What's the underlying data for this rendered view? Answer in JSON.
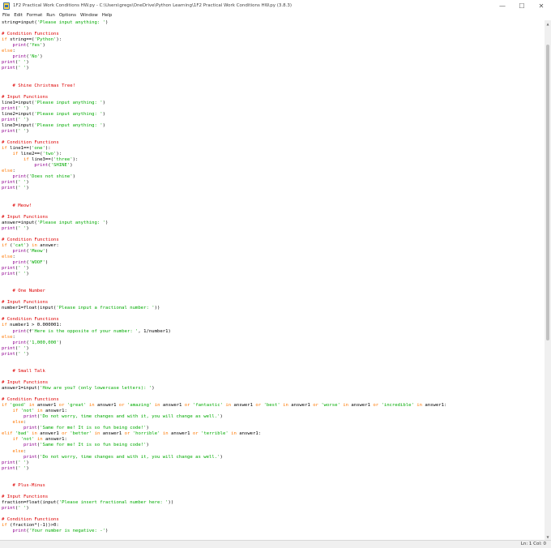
{
  "window": {
    "title": "1F2 Practical Work Conditions HW.py - C:\\Users\\gregs\\OneDrive\\Python Learning\\1F2 Practical Work Conditions HW.py (3.8.3)",
    "minimize": "—",
    "maximize": "☐",
    "close": "✕"
  },
  "menu": {
    "items": [
      "File",
      "Edit",
      "Format",
      "Run",
      "Options",
      "Window",
      "Help"
    ]
  },
  "status": {
    "position": "Ln: 1   Col: 0"
  },
  "scroll": {
    "up": "▲",
    "down": "▼"
  },
  "code_lines": [
    [
      {
        "t": "string=input("
      },
      {
        "t": "'Please input anything: '",
        "c": "string"
      },
      {
        "t": ")"
      }
    ],
    [],
    [
      {
        "t": "# Condition Functions",
        "c": "comment"
      }
    ],
    [
      {
        "t": "if",
        "c": "keyword"
      },
      {
        "t": " string==("
      },
      {
        "t": "'Python'",
        "c": "string"
      },
      {
        "t": "):"
      }
    ],
    [
      {
        "t": "    "
      },
      {
        "t": "print",
        "c": "builtin"
      },
      {
        "t": "("
      },
      {
        "t": "'Yes'",
        "c": "string"
      },
      {
        "t": ")"
      }
    ],
    [
      {
        "t": "else",
        "c": "keyword"
      },
      {
        "t": ":"
      }
    ],
    [
      {
        "t": "    "
      },
      {
        "t": "print",
        "c": "builtin"
      },
      {
        "t": "("
      },
      {
        "t": "'No'",
        "c": "string"
      },
      {
        "t": ")"
      }
    ],
    [
      {
        "t": "print",
        "c": "builtin"
      },
      {
        "t": "("
      },
      {
        "t": "' '",
        "c": "string"
      },
      {
        "t": ")"
      }
    ],
    [
      {
        "t": "print",
        "c": "builtin"
      },
      {
        "t": "("
      },
      {
        "t": "' '",
        "c": "string"
      },
      {
        "t": ")"
      }
    ],
    [],
    [],
    [
      {
        "t": "    "
      },
      {
        "t": "# Shine Christmas Tree!",
        "c": "comment"
      }
    ],
    [],
    [
      {
        "t": "# Input Functions",
        "c": "comment"
      }
    ],
    [
      {
        "t": "line1=input("
      },
      {
        "t": "'Please input anything: '",
        "c": "string"
      },
      {
        "t": ")"
      }
    ],
    [
      {
        "t": "print",
        "c": "builtin"
      },
      {
        "t": "("
      },
      {
        "t": "' '",
        "c": "string"
      },
      {
        "t": ")"
      }
    ],
    [
      {
        "t": "line2=input("
      },
      {
        "t": "'Please input anything: '",
        "c": "string"
      },
      {
        "t": ")"
      }
    ],
    [
      {
        "t": "print",
        "c": "builtin"
      },
      {
        "t": "("
      },
      {
        "t": "' '",
        "c": "string"
      },
      {
        "t": ")"
      }
    ],
    [
      {
        "t": "line3=input("
      },
      {
        "t": "'Please input anything: '",
        "c": "string"
      },
      {
        "t": ")"
      }
    ],
    [
      {
        "t": "print",
        "c": "builtin"
      },
      {
        "t": "("
      },
      {
        "t": "' '",
        "c": "string"
      },
      {
        "t": ")"
      }
    ],
    [],
    [
      {
        "t": "# Condition Functions",
        "c": "comment"
      }
    ],
    [
      {
        "t": "if",
        "c": "keyword"
      },
      {
        "t": " line1==("
      },
      {
        "t": "'one'",
        "c": "string"
      },
      {
        "t": "):"
      }
    ],
    [
      {
        "t": "    "
      },
      {
        "t": "if",
        "c": "keyword"
      },
      {
        "t": " line2==("
      },
      {
        "t": "'two'",
        "c": "string"
      },
      {
        "t": "):"
      }
    ],
    [
      {
        "t": "        "
      },
      {
        "t": "if",
        "c": "keyword"
      },
      {
        "t": " line3==("
      },
      {
        "t": "'three'",
        "c": "string"
      },
      {
        "t": "):"
      }
    ],
    [
      {
        "t": "            "
      },
      {
        "t": "print",
        "c": "builtin"
      },
      {
        "t": "("
      },
      {
        "t": "'SHINE'",
        "c": "string"
      },
      {
        "t": ")"
      }
    ],
    [
      {
        "t": "else",
        "c": "keyword"
      },
      {
        "t": ":"
      }
    ],
    [
      {
        "t": "    "
      },
      {
        "t": "print",
        "c": "builtin"
      },
      {
        "t": "("
      },
      {
        "t": "'Does not shine'",
        "c": "string"
      },
      {
        "t": ")"
      }
    ],
    [
      {
        "t": "print",
        "c": "builtin"
      },
      {
        "t": "("
      },
      {
        "t": "' '",
        "c": "string"
      },
      {
        "t": ")"
      }
    ],
    [
      {
        "t": "print",
        "c": "builtin"
      },
      {
        "t": "("
      },
      {
        "t": "' '",
        "c": "string"
      },
      {
        "t": ")"
      }
    ],
    [],
    [],
    [
      {
        "t": "    "
      },
      {
        "t": "# Meow!",
        "c": "comment"
      }
    ],
    [],
    [
      {
        "t": "# Input Functions",
        "c": "comment"
      }
    ],
    [
      {
        "t": "answer=input("
      },
      {
        "t": "'Please input anything: '",
        "c": "string"
      },
      {
        "t": ")"
      }
    ],
    [
      {
        "t": "print",
        "c": "builtin"
      },
      {
        "t": "("
      },
      {
        "t": "' '",
        "c": "string"
      },
      {
        "t": ")"
      }
    ],
    [],
    [
      {
        "t": "# Condition Functions",
        "c": "comment"
      }
    ],
    [
      {
        "t": "if",
        "c": "keyword"
      },
      {
        "t": " ("
      },
      {
        "t": "'cat'",
        "c": "string"
      },
      {
        "t": ") "
      },
      {
        "t": "in",
        "c": "keyword"
      },
      {
        "t": " answer:"
      }
    ],
    [
      {
        "t": "    "
      },
      {
        "t": "print",
        "c": "builtin"
      },
      {
        "t": "("
      },
      {
        "t": "'Meow'",
        "c": "string"
      },
      {
        "t": ")"
      }
    ],
    [
      {
        "t": "else",
        "c": "keyword"
      },
      {
        "t": ":"
      }
    ],
    [
      {
        "t": "    "
      },
      {
        "t": "print",
        "c": "builtin"
      },
      {
        "t": "("
      },
      {
        "t": "'WOOF'",
        "c": "string"
      },
      {
        "t": ")"
      }
    ],
    [
      {
        "t": "print",
        "c": "builtin"
      },
      {
        "t": "("
      },
      {
        "t": "' '",
        "c": "string"
      },
      {
        "t": ")"
      }
    ],
    [
      {
        "t": "print",
        "c": "builtin"
      },
      {
        "t": "("
      },
      {
        "t": "' '",
        "c": "string"
      },
      {
        "t": ")"
      }
    ],
    [],
    [],
    [
      {
        "t": "    "
      },
      {
        "t": "# One Number",
        "c": "comment"
      }
    ],
    [],
    [
      {
        "t": "# Input Functions",
        "c": "comment"
      }
    ],
    [
      {
        "t": "number1=float(input("
      },
      {
        "t": "'Please input a fractional number: '",
        "c": "string"
      },
      {
        "t": "))"
      }
    ],
    [],
    [
      {
        "t": "# Condition Functions",
        "c": "comment"
      }
    ],
    [
      {
        "t": "if",
        "c": "keyword"
      },
      {
        "t": " number1 > 0.000001:"
      }
    ],
    [
      {
        "t": "    "
      },
      {
        "t": "print",
        "c": "builtin"
      },
      {
        "t": "(f"
      },
      {
        "t": "'Here is the opposite of your number: '",
        "c": "string"
      },
      {
        "t": ", 1/number1)"
      }
    ],
    [
      {
        "t": "else",
        "c": "keyword"
      },
      {
        "t": ":"
      }
    ],
    [
      {
        "t": "    "
      },
      {
        "t": "print",
        "c": "builtin"
      },
      {
        "t": "("
      },
      {
        "t": "'1,000,000'",
        "c": "string"
      },
      {
        "t": ")"
      }
    ],
    [
      {
        "t": "print",
        "c": "builtin"
      },
      {
        "t": "("
      },
      {
        "t": "' '",
        "c": "string"
      },
      {
        "t": ")"
      }
    ],
    [
      {
        "t": "print",
        "c": "builtin"
      },
      {
        "t": "("
      },
      {
        "t": "' '",
        "c": "string"
      },
      {
        "t": ")"
      }
    ],
    [],
    [],
    [
      {
        "t": "    "
      },
      {
        "t": "# Small Talk",
        "c": "comment"
      }
    ],
    [],
    [
      {
        "t": "# Input Functions",
        "c": "comment"
      }
    ],
    [
      {
        "t": "answer1=input("
      },
      {
        "t": "'How are you? (only lowercase letters): '",
        "c": "string"
      },
      {
        "t": ")"
      }
    ],
    [],
    [
      {
        "t": "# Condition Functions",
        "c": "comment"
      }
    ],
    [
      {
        "t": "if",
        "c": "keyword"
      },
      {
        "t": " "
      },
      {
        "t": "'good'",
        "c": "string"
      },
      {
        "t": " "
      },
      {
        "t": "in",
        "c": "keyword"
      },
      {
        "t": " answer1 "
      },
      {
        "t": "or",
        "c": "keyword"
      },
      {
        "t": " "
      },
      {
        "t": "'great'",
        "c": "string"
      },
      {
        "t": " "
      },
      {
        "t": "in",
        "c": "keyword"
      },
      {
        "t": " answer1 "
      },
      {
        "t": "or",
        "c": "keyword"
      },
      {
        "t": " "
      },
      {
        "t": "'amazing'",
        "c": "string"
      },
      {
        "t": " "
      },
      {
        "t": "in",
        "c": "keyword"
      },
      {
        "t": " answer1 "
      },
      {
        "t": "or",
        "c": "keyword"
      },
      {
        "t": " "
      },
      {
        "t": "'fantastic'",
        "c": "string"
      },
      {
        "t": " "
      },
      {
        "t": "in",
        "c": "keyword"
      },
      {
        "t": " answer1 "
      },
      {
        "t": "or",
        "c": "keyword"
      },
      {
        "t": " "
      },
      {
        "t": "'best'",
        "c": "string"
      },
      {
        "t": " "
      },
      {
        "t": "in",
        "c": "keyword"
      },
      {
        "t": " answer1 "
      },
      {
        "t": "or",
        "c": "keyword"
      },
      {
        "t": " "
      },
      {
        "t": "'worse'",
        "c": "string"
      },
      {
        "t": " "
      },
      {
        "t": "in",
        "c": "keyword"
      },
      {
        "t": " answer1 "
      },
      {
        "t": "or",
        "c": "keyword"
      },
      {
        "t": " "
      },
      {
        "t": "'incredible'",
        "c": "string"
      },
      {
        "t": " "
      },
      {
        "t": "in",
        "c": "keyword"
      },
      {
        "t": " answer1:"
      }
    ],
    [
      {
        "t": "    "
      },
      {
        "t": "if",
        "c": "keyword"
      },
      {
        "t": " "
      },
      {
        "t": "'not'",
        "c": "string"
      },
      {
        "t": " "
      },
      {
        "t": "in",
        "c": "keyword"
      },
      {
        "t": " answer1:"
      }
    ],
    [
      {
        "t": "        "
      },
      {
        "t": "print",
        "c": "builtin"
      },
      {
        "t": "("
      },
      {
        "t": "'Do not worry, time changes and with it, you will change as well.'",
        "c": "string"
      },
      {
        "t": ")"
      }
    ],
    [
      {
        "t": "    "
      },
      {
        "t": "else",
        "c": "keyword"
      },
      {
        "t": ":"
      }
    ],
    [
      {
        "t": "        "
      },
      {
        "t": "print",
        "c": "builtin"
      },
      {
        "t": "("
      },
      {
        "t": "'Same for me! It is so fun being code!'",
        "c": "string"
      },
      {
        "t": ")"
      }
    ],
    [
      {
        "t": "elif",
        "c": "keyword"
      },
      {
        "t": " "
      },
      {
        "t": "'bad'",
        "c": "string"
      },
      {
        "t": " "
      },
      {
        "t": "in",
        "c": "keyword"
      },
      {
        "t": " answer1 "
      },
      {
        "t": "or",
        "c": "keyword"
      },
      {
        "t": " "
      },
      {
        "t": "'better'",
        "c": "string"
      },
      {
        "t": " "
      },
      {
        "t": "in",
        "c": "keyword"
      },
      {
        "t": " answer1 "
      },
      {
        "t": "or",
        "c": "keyword"
      },
      {
        "t": " "
      },
      {
        "t": "'horrible'",
        "c": "string"
      },
      {
        "t": " "
      },
      {
        "t": "in",
        "c": "keyword"
      },
      {
        "t": " answer1 "
      },
      {
        "t": "or",
        "c": "keyword"
      },
      {
        "t": " "
      },
      {
        "t": "'terrible'",
        "c": "string"
      },
      {
        "t": " "
      },
      {
        "t": "in",
        "c": "keyword"
      },
      {
        "t": " answer1:"
      }
    ],
    [
      {
        "t": "    "
      },
      {
        "t": "if",
        "c": "keyword"
      },
      {
        "t": " "
      },
      {
        "t": "'not'",
        "c": "string"
      },
      {
        "t": " "
      },
      {
        "t": "in",
        "c": "keyword"
      },
      {
        "t": " answer1:"
      }
    ],
    [
      {
        "t": "        "
      },
      {
        "t": "print",
        "c": "builtin"
      },
      {
        "t": "("
      },
      {
        "t": "'Same for me! It is so fun being code!'",
        "c": "string"
      },
      {
        "t": ")"
      }
    ],
    [
      {
        "t": "    "
      },
      {
        "t": "else",
        "c": "keyword"
      },
      {
        "t": ":"
      }
    ],
    [
      {
        "t": "        "
      },
      {
        "t": "print",
        "c": "builtin"
      },
      {
        "t": "("
      },
      {
        "t": "'Do not worry, time changes and with it, you will change as well.'",
        "c": "string"
      },
      {
        "t": ")"
      }
    ],
    [
      {
        "t": "print",
        "c": "builtin"
      },
      {
        "t": "("
      },
      {
        "t": "' '",
        "c": "string"
      },
      {
        "t": ")"
      }
    ],
    [
      {
        "t": "print",
        "c": "builtin"
      },
      {
        "t": "("
      },
      {
        "t": "' '",
        "c": "string"
      },
      {
        "t": ")"
      }
    ],
    [],
    [],
    [
      {
        "t": "    "
      },
      {
        "t": "# Plus-Minus",
        "c": "comment"
      }
    ],
    [],
    [
      {
        "t": "# Input Functions",
        "c": "comment"
      }
    ],
    [
      {
        "t": "fraction=float(input("
      },
      {
        "t": "'Please insert fractional number here: '",
        "c": "string"
      },
      {
        "t": "))"
      }
    ],
    [
      {
        "t": "print",
        "c": "builtin"
      },
      {
        "t": "("
      },
      {
        "t": "' '",
        "c": "string"
      },
      {
        "t": ")"
      }
    ],
    [],
    [
      {
        "t": "# Condition Functions",
        "c": "comment"
      }
    ],
    [
      {
        "t": "if",
        "c": "keyword"
      },
      {
        "t": " (fraction*(-1))>0:"
      }
    ],
    [
      {
        "t": "    "
      },
      {
        "t": "print",
        "c": "builtin"
      },
      {
        "t": "("
      },
      {
        "t": "'Your number is negative: -'",
        "c": "string"
      },
      {
        "t": ")"
      }
    ]
  ]
}
